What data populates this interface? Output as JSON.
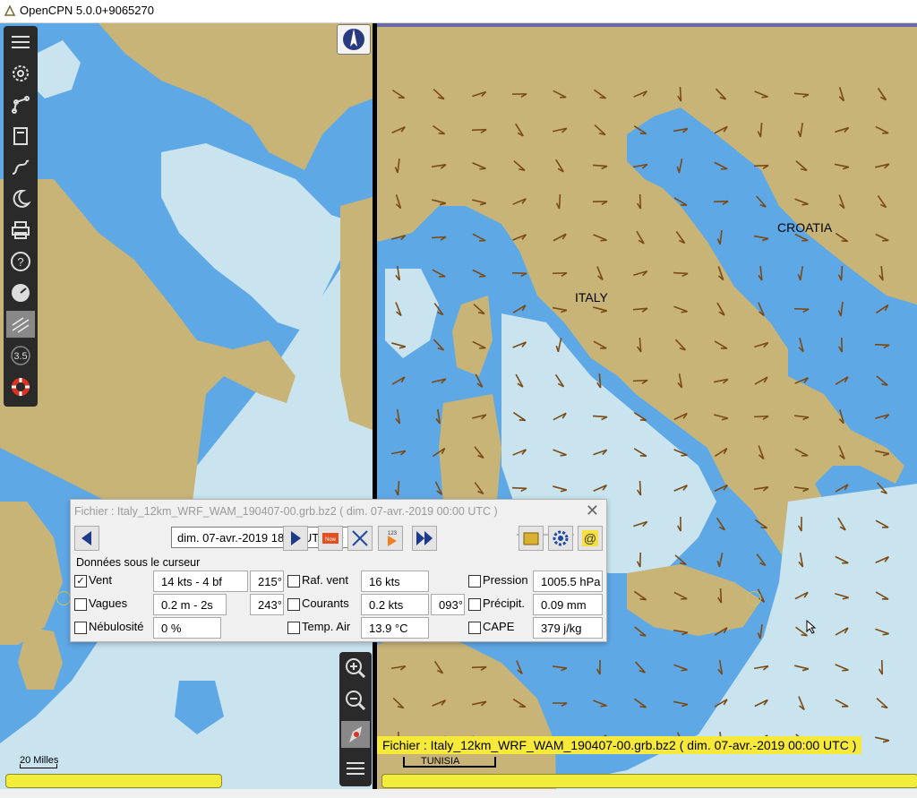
{
  "app": {
    "title": "OpenCPN 5.0.0+9065270"
  },
  "map": {
    "labels": {
      "croatia": "CROATIA",
      "italy": "ITALY"
    },
    "scale_left": "20 Milles",
    "scale_right": "TUNISIA",
    "banner": "Fichier : Italy_12km_WRF_WAM_190407-00.grb.bz2 ( dim. 07-avr.-2019 00:00  UTC )",
    "colors": {
      "land": "#c8b476",
      "shallow": "#5fa8e6",
      "deep": "#c9e4ee",
      "arrow": "#7a4a16"
    }
  },
  "toolbar": {
    "items": [
      "menu-icon",
      "settings-icon",
      "route-icon",
      "layers-icon",
      "track-icon",
      "moon-icon",
      "print-icon",
      "help-icon",
      "dashboard-icon",
      "grib-icon",
      "scale-icon",
      "lifering-icon"
    ],
    "scale_value": "3.5"
  },
  "zoom": {
    "items": [
      "zoom-in-icon",
      "zoom-out-icon",
      "ship-icon",
      "menu-icon"
    ]
  },
  "grib": {
    "title": "Fichier : Italy_12km_WRF_WAM_190407-00.grb.bz2 ( dim. 07-avr.-2019 00:00  UTC )",
    "close_label": "✕",
    "time_select": "dim. 07-avr.-2019 18:00  UTC",
    "now_label": "Now",
    "section_label": "Données sous le curseur",
    "rows": [
      {
        "label": "Vent",
        "checked": true,
        "value": "14 kts -  4 bf",
        "dir": "215°"
      },
      {
        "label": "Vagues",
        "checked": false,
        "value": "0.2 m - 2s",
        "dir": "243°"
      },
      {
        "label": "Nébulosité",
        "checked": false,
        "value": "0 %"
      }
    ],
    "mid": [
      {
        "label": "Raf. vent",
        "checked": false,
        "value": "16 kts"
      },
      {
        "label": "Courants",
        "checked": false,
        "value": "0.2 kts",
        "dir": "093°"
      },
      {
        "label": "Temp. Air",
        "checked": false,
        "value": "13.9 °C"
      }
    ],
    "right": [
      {
        "label": "Pression",
        "checked": false,
        "value": "1005.5 hPa"
      },
      {
        "label": "Précipit.",
        "checked": false,
        "value": "0.09 mm"
      },
      {
        "label": "CAPE",
        "checked": false,
        "value": "379 j/kg"
      }
    ],
    "slider_level": 0.2
  }
}
